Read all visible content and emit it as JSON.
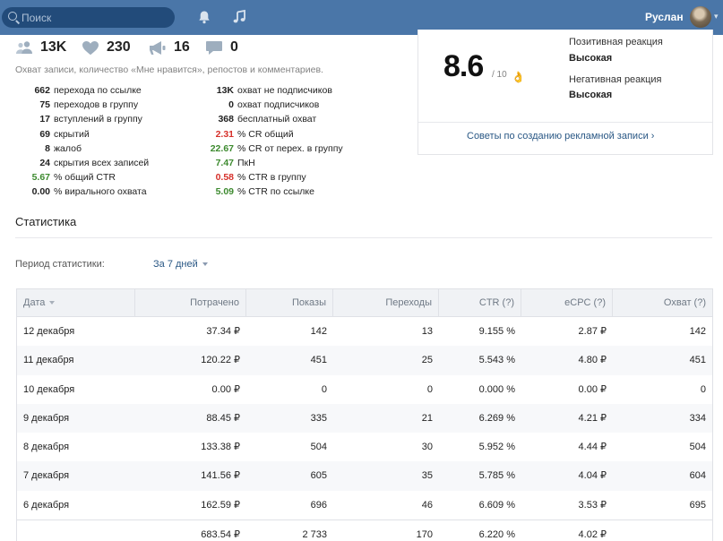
{
  "topbar": {
    "search_placeholder": "Поиск",
    "user_name": "Руслан"
  },
  "counters": {
    "reach": "13K",
    "likes": "230",
    "reposts": "16",
    "comments": "0"
  },
  "counters_note": "Охват записи, количество «Мне нравится», репостов и комментариев.",
  "metrics_left": [
    {
      "value": "662",
      "label": "перехода по ссылке",
      "color": "default"
    },
    {
      "value": "75",
      "label": "переходов в группу",
      "color": "default"
    },
    {
      "value": "17",
      "label": "вступлений в группу",
      "color": "default"
    },
    {
      "value": "69",
      "label": "скрытий",
      "color": "default"
    },
    {
      "value": "8",
      "label": "жалоб",
      "color": "default"
    },
    {
      "value": "24",
      "label": "скрытия всех записей",
      "color": "default"
    },
    {
      "value": "5.67",
      "label": "% общий CTR",
      "color": "green"
    },
    {
      "value": "0.00",
      "label": "% вирального охвата",
      "color": "default"
    }
  ],
  "metrics_right": [
    {
      "value": "13K",
      "label": "охват не подписчиков",
      "color": "default"
    },
    {
      "value": "0",
      "label": "охват подписчиков",
      "color": "default"
    },
    {
      "value": "368",
      "label": "бесплатный охват",
      "color": "default"
    },
    {
      "value": "2.31",
      "label": "% CR общий",
      "color": "red"
    },
    {
      "value": "22.67",
      "label": "% CR от перех. в группу",
      "color": "green"
    },
    {
      "value": "7.47",
      "label": "ПкН",
      "color": "green"
    },
    {
      "value": "0.58",
      "label": "% CTR в группу",
      "color": "red"
    },
    {
      "value": "5.09",
      "label": "% CTR по ссылке",
      "color": "green"
    }
  ],
  "score_card": {
    "score": "8.6",
    "score_of": "/ 10",
    "positive_label": "Позитивная реакция",
    "positive_value": "Высокая",
    "negative_label": "Негативная реакция",
    "negative_value": "Высокая",
    "tips_link": "Советы по созданию рекламной записи ›"
  },
  "statistics": {
    "title": "Статистика",
    "period_label": "Период статистики:",
    "period_value": "За 7 дней",
    "columns": [
      "Дата",
      "Потрачено",
      "Показы",
      "Переходы",
      "CTR (?)",
      "eCPC (?)",
      "Охват (?)"
    ],
    "rows": [
      [
        "12 декабря",
        "37.34 ₽",
        "142",
        "13",
        "9.155 %",
        "2.87 ₽",
        "142"
      ],
      [
        "11 декабря",
        "120.22 ₽",
        "451",
        "25",
        "5.543 %",
        "4.80 ₽",
        "451"
      ],
      [
        "10 декабря",
        "0.00 ₽",
        "0",
        "0",
        "0.000 %",
        "0.00 ₽",
        "0"
      ],
      [
        "9 декабря",
        "88.45 ₽",
        "335",
        "21",
        "6.269 %",
        "4.21 ₽",
        "334"
      ],
      [
        "8 декабря",
        "133.38 ₽",
        "504",
        "30",
        "5.952 %",
        "4.44 ₽",
        "504"
      ],
      [
        "7 декабря",
        "141.56 ₽",
        "605",
        "35",
        "5.785 %",
        "4.04 ₽",
        "604"
      ],
      [
        "6 декабря",
        "162.59 ₽",
        "696",
        "46",
        "6.609 %",
        "3.53 ₽",
        "695"
      ]
    ],
    "total": [
      "",
      "683.54 ₽",
      "2 733",
      "170",
      "6.220 %",
      "4.02 ₽",
      ""
    ]
  },
  "colors": {
    "header_bg": "#4a76a8",
    "link": "#2a5885",
    "positive": "#3d8a2f",
    "negative": "#d6312b"
  },
  "icons": [
    "search-icon",
    "bell-icon",
    "music-icon",
    "people-icon",
    "heart-icon",
    "megaphone-icon",
    "comment-icon",
    "ok-hand-icon",
    "chevron-down-icon"
  ]
}
